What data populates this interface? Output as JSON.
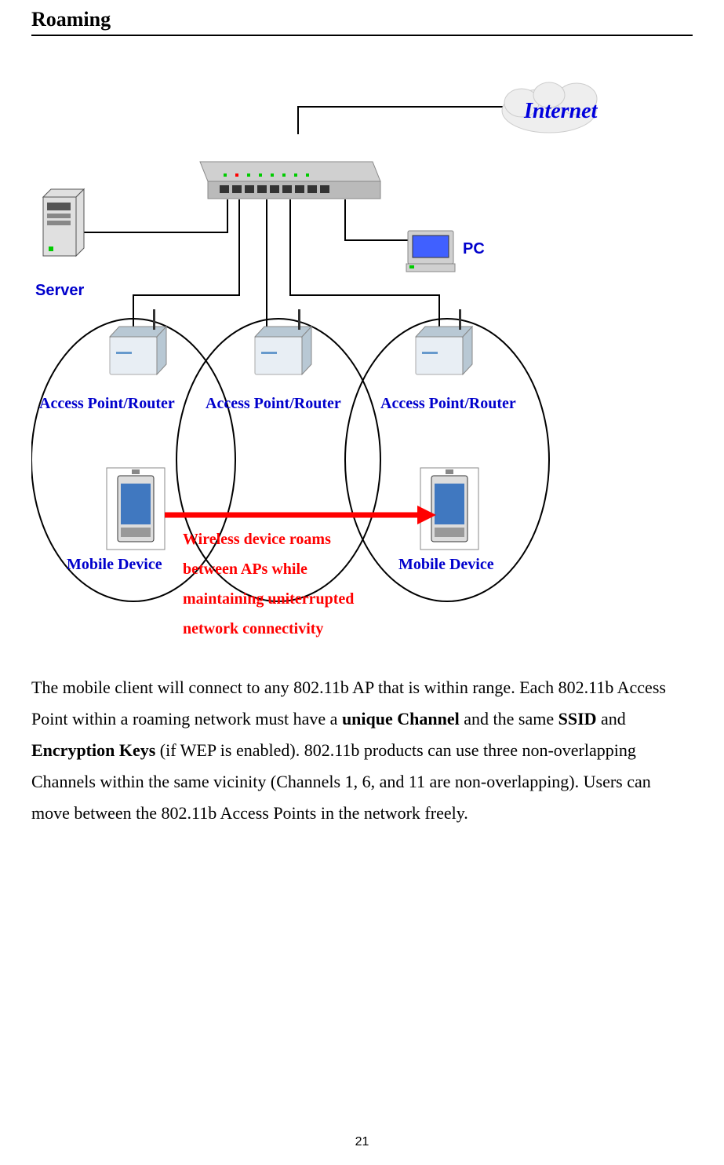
{
  "header": {
    "title": "Roaming"
  },
  "diagram": {
    "internet": "Internet",
    "server": "Server",
    "pc": "PC",
    "ap": "Access Point/Router",
    "mobile": "Mobile Device",
    "annotation_l1": "Wireless device roams",
    "annotation_l2": "between APs while",
    "annotation_l3": "maintaining uniterrupted",
    "annotation_l4": "network connectivity"
  },
  "body": {
    "p1_a": "The mobile client will connect to any 802.11b AP that is within range. Each 802.11b Access Point within a roaming network must have a ",
    "p1_b1": "unique Channel",
    "p1_c": " and the same ",
    "p1_b2": "SSID",
    "p1_d": " and ",
    "p1_b3": "Encryption Keys",
    "p1_e": " (if WEP is enabled). 802.11b products can use three non-overlapping Channels within the same vicinity (Channels 1, 6, and 11 are non-overlapping). Users can move between the 802.11b Access Points in the network freely."
  },
  "page_number": "21"
}
